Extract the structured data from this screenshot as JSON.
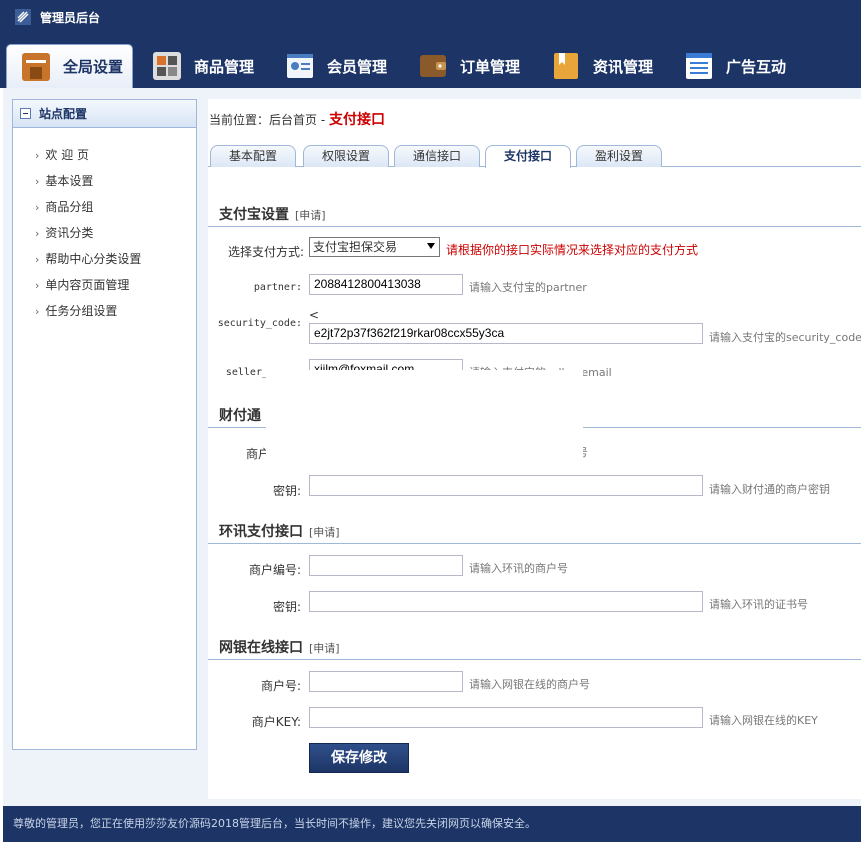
{
  "app": {
    "title": "管理员后台"
  },
  "nav": {
    "tabs": [
      {
        "label": "全局设置",
        "active": true
      },
      {
        "label": "商品管理"
      },
      {
        "label": "会员管理"
      },
      {
        "label": "订单管理"
      },
      {
        "label": "资讯管理"
      },
      {
        "label": "广告互动"
      }
    ]
  },
  "sidebar": {
    "header": "站点配置",
    "items": [
      "欢 迎 页",
      "基本设置",
      "商品分组",
      "资讯分类",
      "帮助中心分类设置",
      "单内容页面管理",
      "任务分组设置"
    ]
  },
  "breadcrumb": {
    "prefix": "当前位置：后台首页 - ",
    "current": "支付接口"
  },
  "subtabs": [
    "基本配置",
    "权限设置",
    "通信接口",
    "支付接口",
    "盈利设置"
  ],
  "alipay": {
    "title": "支付宝设置",
    "apply": "[申请]",
    "method_label": "选择支付方式:",
    "method_value": "支付宝担保交易",
    "method_hint": "请根据你的接口实际情况来选择对应的支付方式",
    "partner_label": "partner:",
    "partner_value": "2088412800413038",
    "partner_hint": "请输入支付宝的partner",
    "code_label": "security_code:",
    "code_marker": "<",
    "code_value": "e2jt72p37f362f219rkar08ccx55y3ca",
    "code_hint": "请输入支付宝的security_code",
    "email_label": "seller_",
    "email_value": "xiilm@foxmail.com",
    "email_hint": "请输入支付宝的seller_email"
  },
  "tenpay": {
    "title": "财付通",
    "merchant_label": "商户",
    "merchant_hint": "号",
    "key_label": "密钥:",
    "key_value": "",
    "key_hint": "请输入财付通的商户密钥"
  },
  "ips": {
    "title": "环讯支付接口",
    "apply": "[申请]",
    "merchant_label": "商户编号:",
    "merchant_value": "",
    "merchant_hint": "请输入环讯的商户号",
    "key_label": "密钥:",
    "key_value": "",
    "key_hint": "请输入环讯的证书号"
  },
  "chinabank": {
    "title": "网银在线接口",
    "apply": "[申请]",
    "merchant_label": "商户号:",
    "merchant_value": "",
    "merchant_hint": "请输入网银在线的商户号",
    "key_label": "商户KEY:",
    "key_value": "",
    "key_hint": "请输入网银在线的KEY"
  },
  "save_label": "保存修改",
  "footer": "尊敬的管理员，您正在使用莎莎友价源码2018管理后台，当长时间不操作，建议您先关闭网页以确保安全。",
  "colors": {
    "brand": "#1d3566",
    "accent_red": "#cc0000",
    "panel_bg": "#eef3fa",
    "border": "#9fb7d9"
  }
}
